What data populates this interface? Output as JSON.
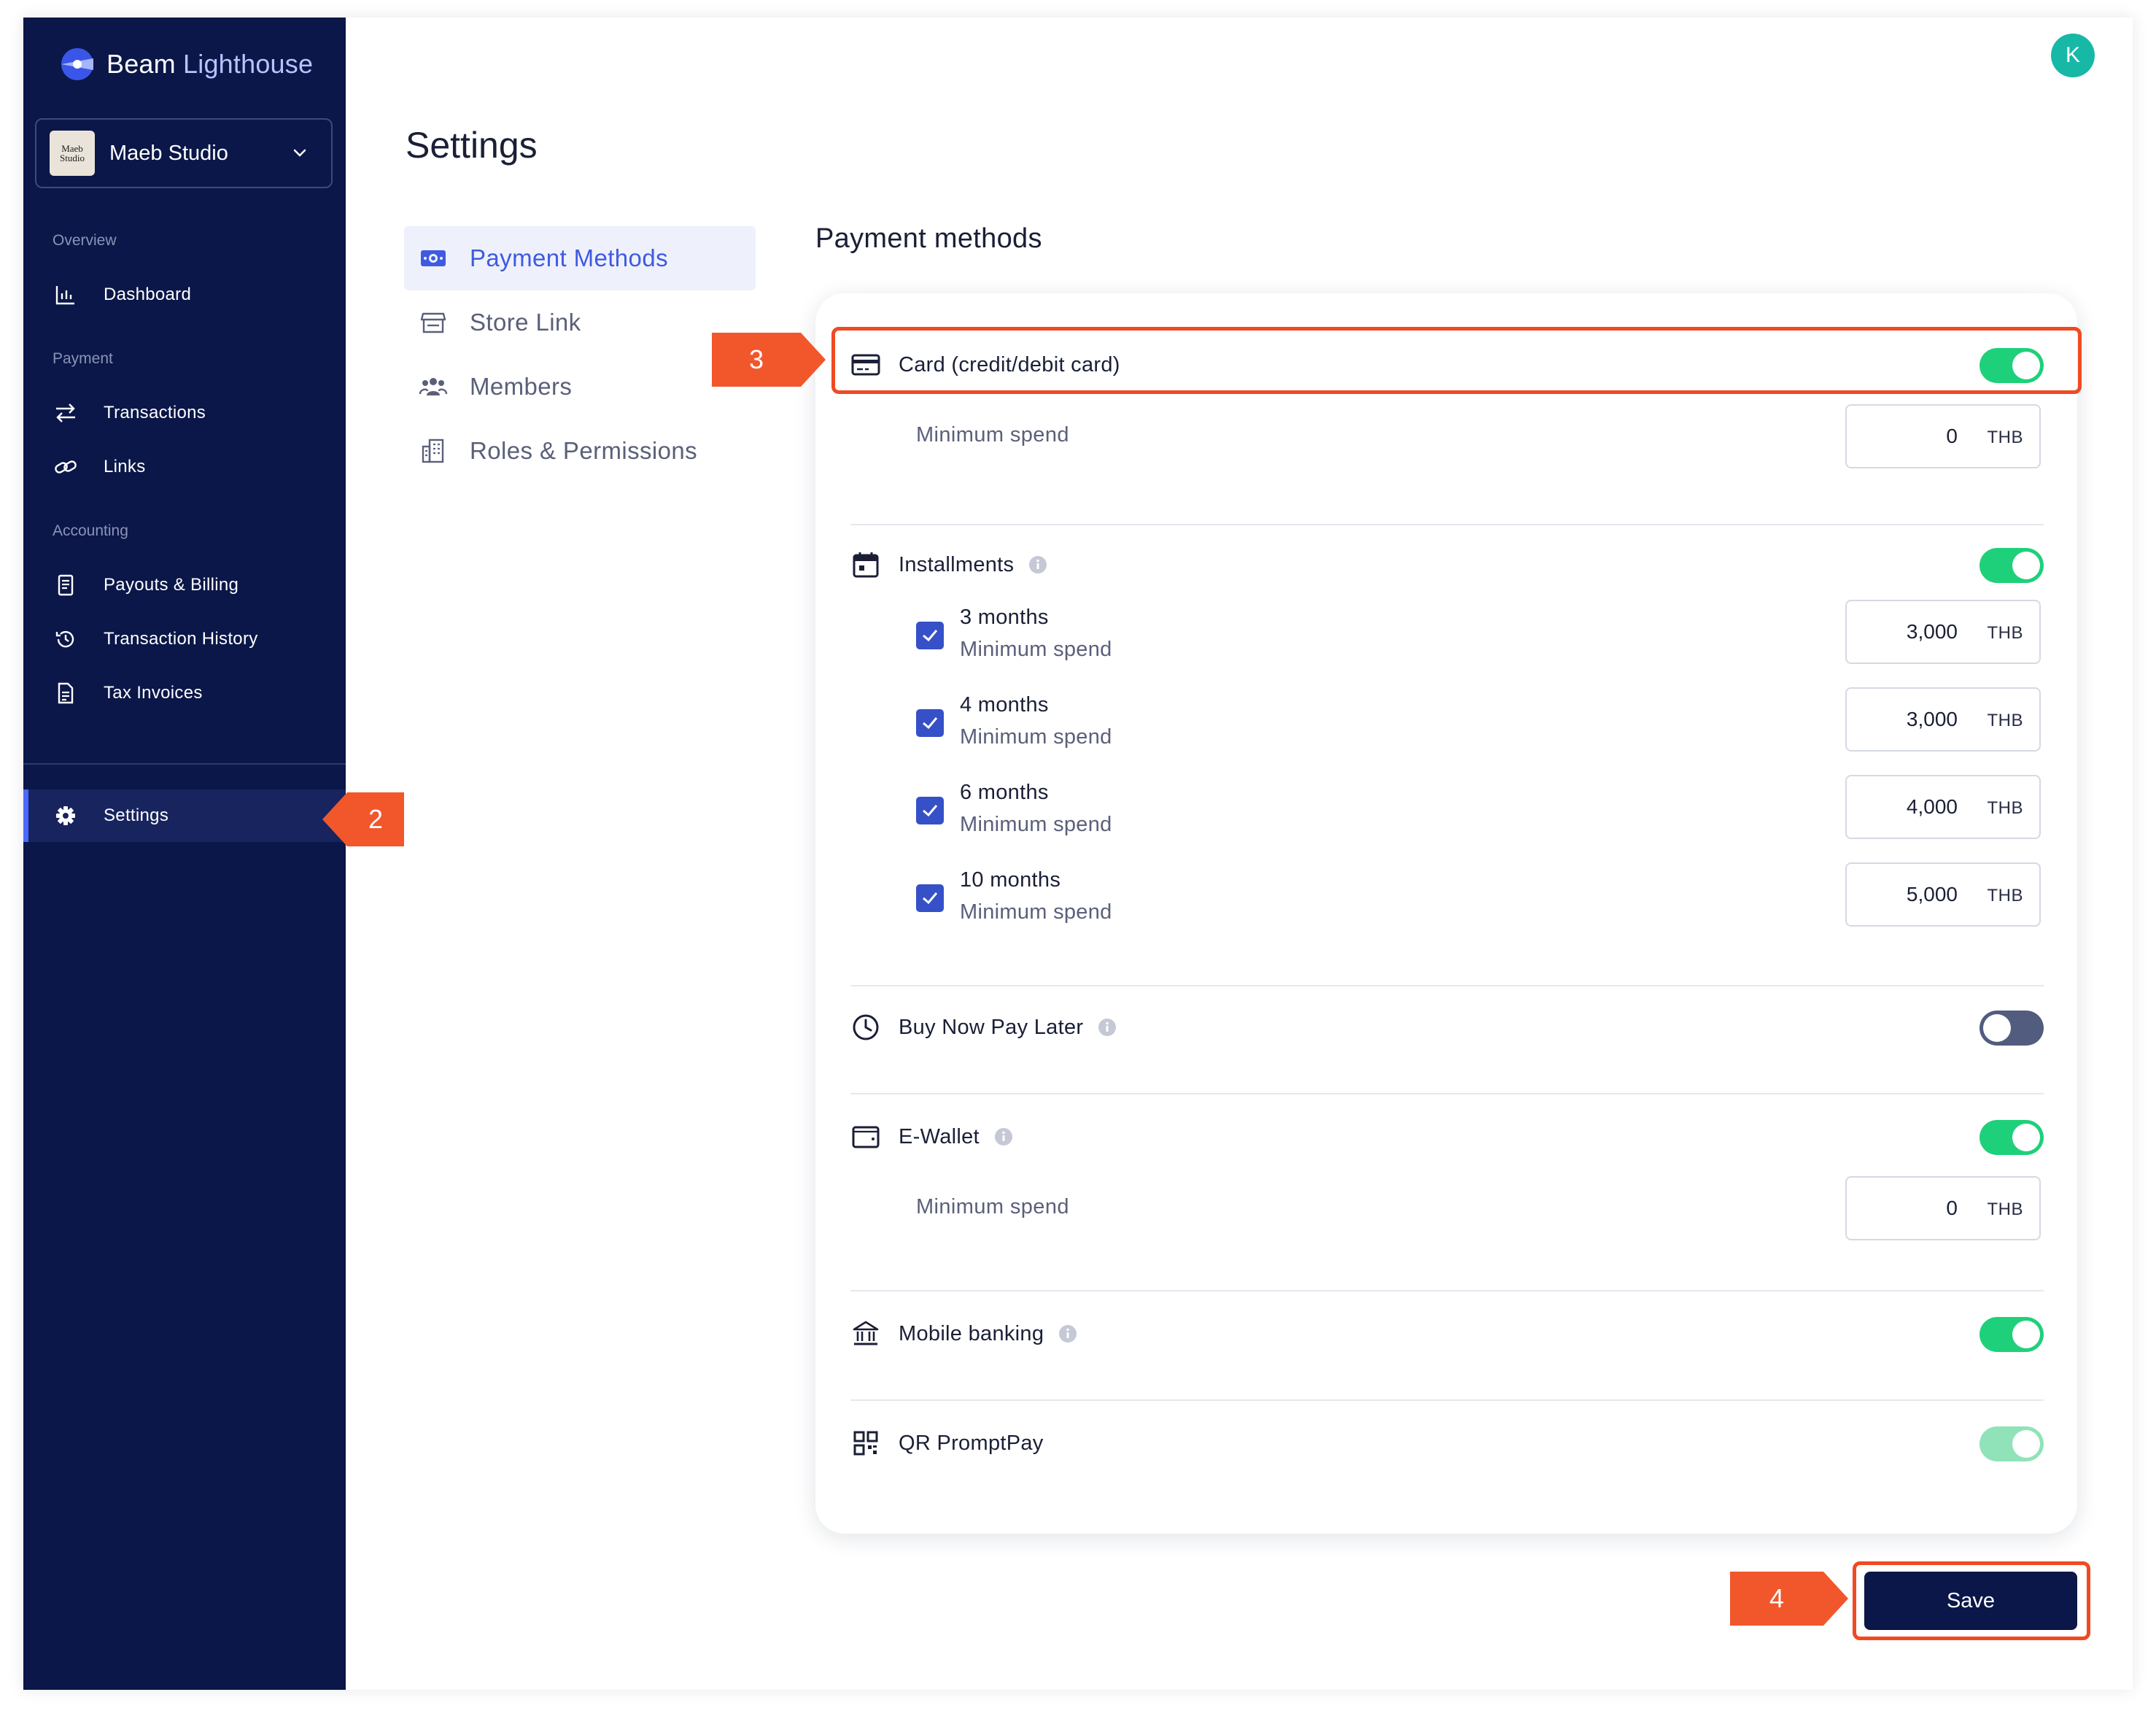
{
  "app": {
    "brand_first": "Beam",
    "brand_second": " Lighthouse",
    "user_initial": "K"
  },
  "store": {
    "name": "Maeb Studio",
    "avatar_text": "Maeb Studio"
  },
  "sidebar": {
    "sections": {
      "overview": "Overview",
      "payment": "Payment",
      "accounting": "Accounting"
    },
    "items": {
      "dashboard": "Dashboard",
      "transactions": "Transactions",
      "links": "Links",
      "payouts": "Payouts & Billing",
      "history": "Transaction History",
      "tax": "Tax Invoices",
      "settings": "Settings"
    }
  },
  "page": {
    "title": "Settings",
    "section_title": "Payment methods"
  },
  "subnav": {
    "payment_methods": "Payment Methods",
    "store_link": "Store Link",
    "members": "Members",
    "roles": "Roles & Permissions"
  },
  "methods": {
    "card": {
      "label": "Card (credit/debit card)",
      "enabled": true,
      "min_label": "Minimum spend",
      "min_value": "0",
      "currency": "THB"
    },
    "installments": {
      "label": "Installments",
      "enabled": true,
      "plans": [
        {
          "title": "3 months",
          "sub": "Minimum spend",
          "value": "3,000",
          "currency": "THB",
          "checked": true
        },
        {
          "title": "4 months",
          "sub": "Minimum spend",
          "value": "3,000",
          "currency": "THB",
          "checked": true
        },
        {
          "title": "6 months",
          "sub": "Minimum spend",
          "value": "4,000",
          "currency": "THB",
          "checked": true
        },
        {
          "title": "10 months",
          "sub": "Minimum spend",
          "value": "5,000",
          "currency": "THB",
          "checked": true
        }
      ]
    },
    "bnpl": {
      "label": "Buy Now Pay Later",
      "enabled": false
    },
    "ewallet": {
      "label": "E-Wallet",
      "enabled": true,
      "min_label": "Minimum spend",
      "min_value": "0",
      "currency": "THB"
    },
    "mobile_banking": {
      "label": "Mobile banking",
      "enabled": true
    },
    "qr": {
      "label": "QR PromptPay",
      "enabled": true,
      "locked": true
    }
  },
  "actions": {
    "save": "Save"
  },
  "annotations": {
    "step2": "2",
    "step3": "3",
    "step4": "4"
  },
  "colors": {
    "sidebar_bg": "#0b1748",
    "accent": "#3f5ae0",
    "toggle_on": "#1fd07a",
    "toggle_off": "#515c7e",
    "annotation": "#f2562b"
  }
}
